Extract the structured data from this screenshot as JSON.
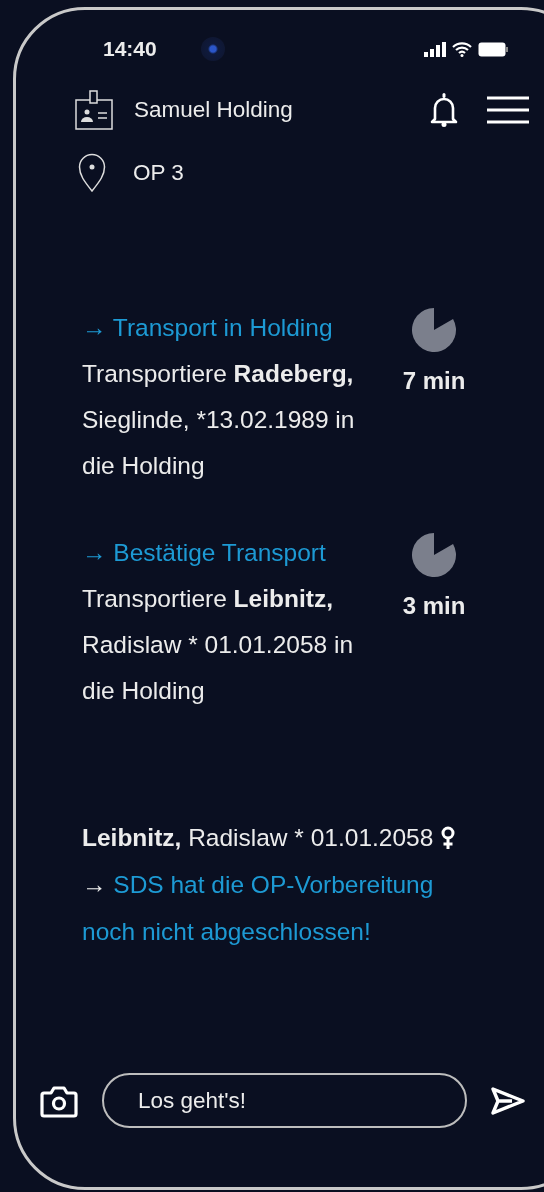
{
  "status_bar": {
    "time": "14:40"
  },
  "header": {
    "user": "Samuel Holding",
    "location": "OP 3"
  },
  "tasks": [
    {
      "title": "→ Transport in Holding",
      "lead": "Transportiere",
      "name": "Radeberg,",
      "rest": "Sieglinde, *13.02.1989 in die Holding",
      "duration": "7 min"
    },
    {
      "title": "→ Bestätige Transport",
      "lead": "Transportiere",
      "name": "Leibnitz,",
      "rest": "Radislaw * 01.01.2058 in die Holding",
      "duration": "3 min"
    }
  ],
  "alert": {
    "name": "Leibnitz,",
    "rest": "Radislaw * 01.01.2058",
    "arrow": "→",
    "message": "SDS hat die OP-Vorbereitung noch nicht abgeschlossen!"
  },
  "composer": {
    "value": "Los geht's!"
  }
}
